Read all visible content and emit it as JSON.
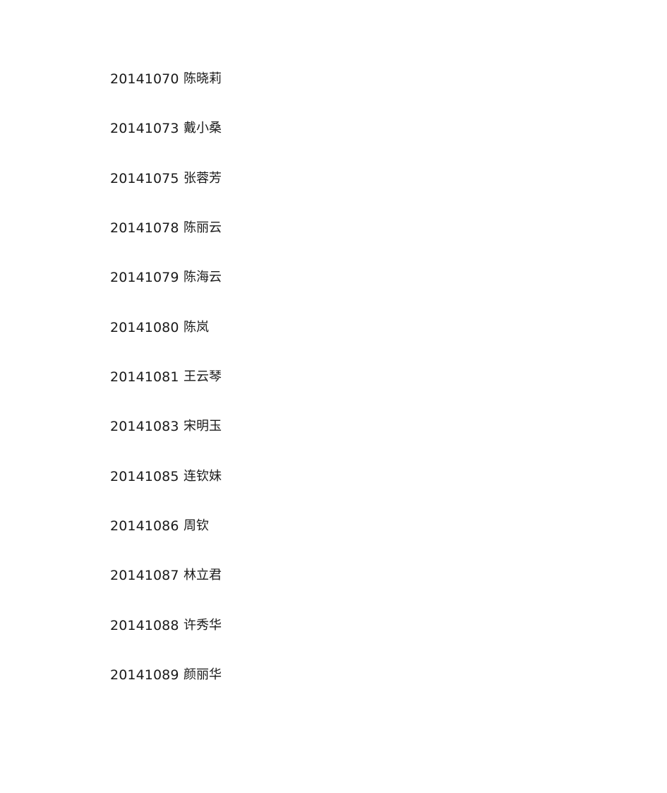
{
  "document": {
    "entries": [
      {
        "id": "20141070",
        "name": "陈晓莉"
      },
      {
        "id": "20141073",
        "name": "戴小桑"
      },
      {
        "id": "20141075",
        "name": "张蓉芳"
      },
      {
        "id": "20141078",
        "name": "陈丽云"
      },
      {
        "id": "20141079",
        "name": "陈海云"
      },
      {
        "id": "20141080",
        "name": "陈岚"
      },
      {
        "id": "20141081",
        "name": "王云琴"
      },
      {
        "id": "20141083",
        "name": "宋明玉"
      },
      {
        "id": "20141085",
        "name": "连钦妹"
      },
      {
        "id": "20141086",
        "name": "周钦"
      },
      {
        "id": "20141087",
        "name": "林立君"
      },
      {
        "id": "20141088",
        "name": "许秀华"
      },
      {
        "id": "20141089",
        "name": "颜丽华"
      }
    ]
  }
}
